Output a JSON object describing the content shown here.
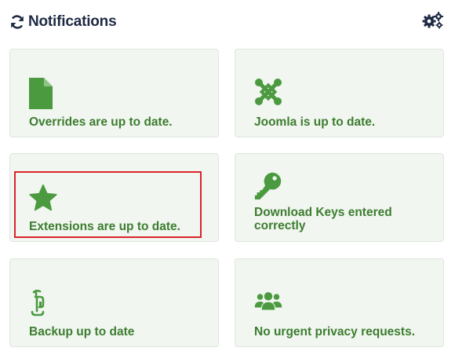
{
  "header": {
    "title": "Notifications",
    "refresh_icon": "refresh-icon",
    "settings_icon": "gears-icon"
  },
  "accent_color": "#3c7d2f",
  "icon_color": "#4b9a40",
  "highlight_color": "#d9252b",
  "cards": [
    {
      "id": "overrides",
      "icon": "file-icon",
      "label": "Overrides are up to date."
    },
    {
      "id": "joomla",
      "icon": "joomla-logo-icon",
      "label": "Joomla is up to date."
    },
    {
      "id": "extensions",
      "icon": "star-icon",
      "label": "Extensions are up to date.",
      "highlighted": true
    },
    {
      "id": "keys",
      "icon": "key-icon",
      "label": "Download Keys entered correctly"
    },
    {
      "id": "backup",
      "icon": "backup-icon",
      "label": "Backup up to date"
    },
    {
      "id": "privacy",
      "icon": "users-icon",
      "label": "No urgent privacy requests."
    }
  ]
}
